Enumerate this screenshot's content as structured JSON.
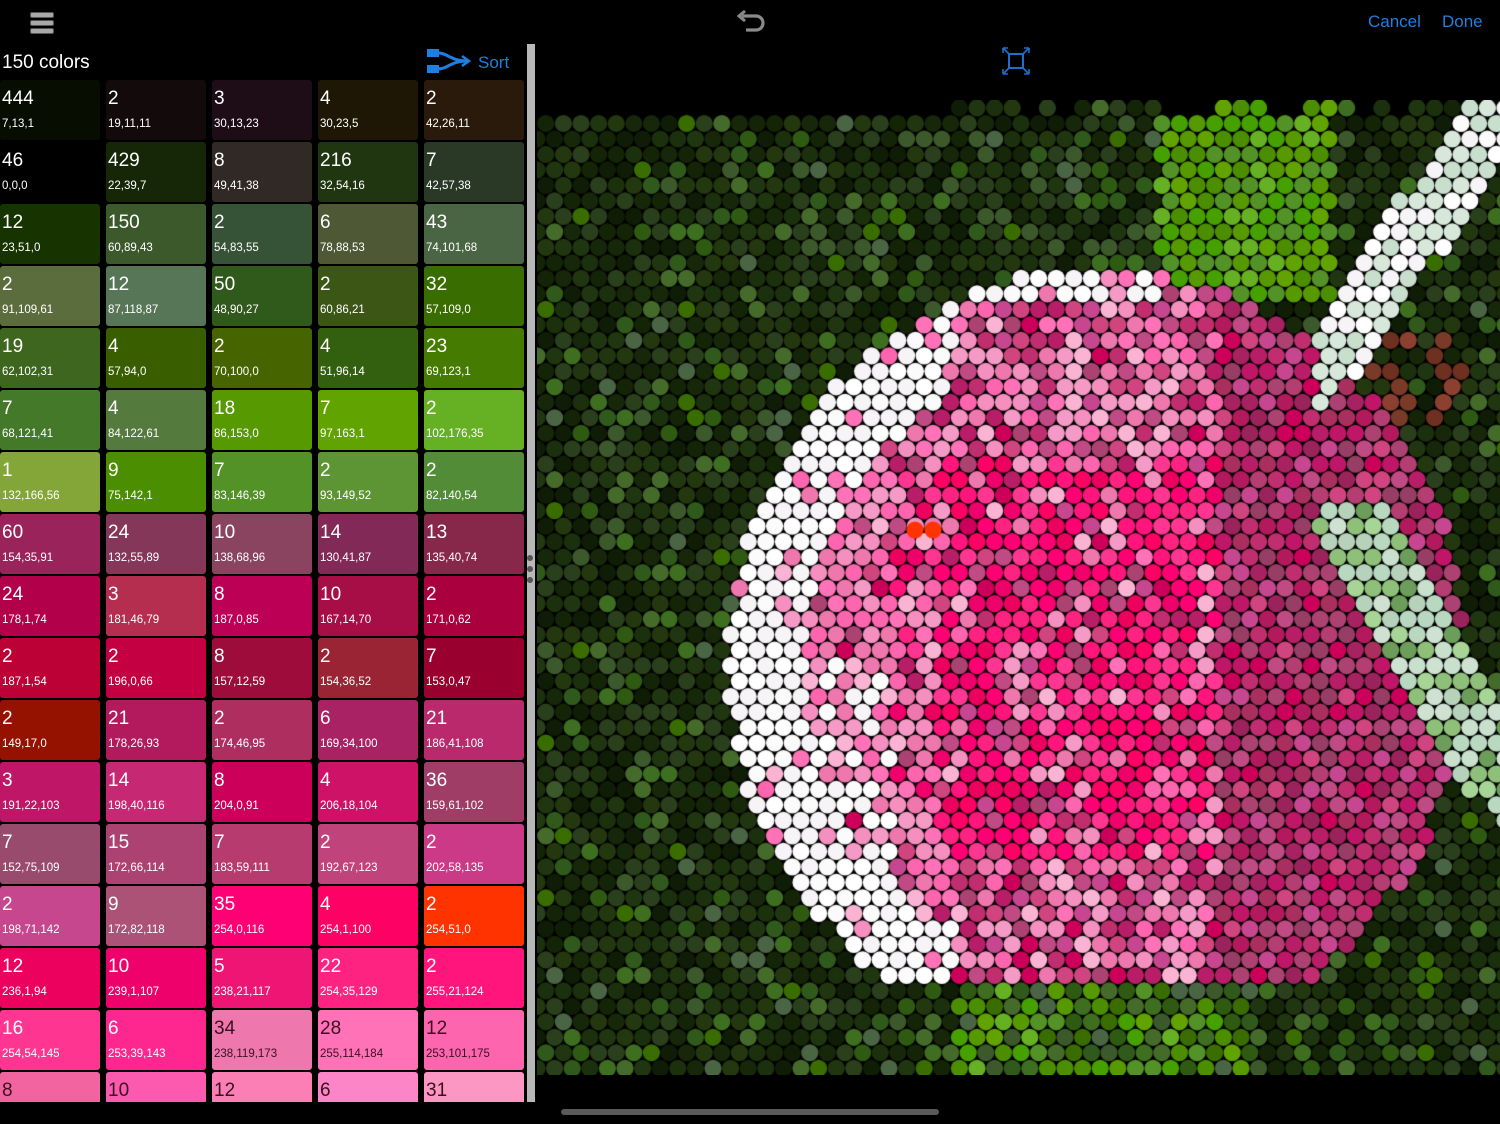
{
  "toolbar": {
    "menu_icon": "hamburger-menu-icon",
    "undo_icon": "undo-icon",
    "fit_icon": "fit-to-screen-icon",
    "cancel_label": "Cancel",
    "done_label": "Done",
    "accent_color": "#1f7fe0"
  },
  "palette_panel": {
    "count_label": "150 colors",
    "sort_label": "Sort",
    "sort_icon": "sort-branch-icon",
    "swatches": [
      {
        "count": "444",
        "rgb": "7,13,1"
      },
      {
        "count": "2",
        "rgb": "19,11,11"
      },
      {
        "count": "3",
        "rgb": "30,13,23"
      },
      {
        "count": "4",
        "rgb": "30,23,5"
      },
      {
        "count": "2",
        "rgb": "42,26,11"
      },
      {
        "count": "46",
        "rgb": "0,0,0"
      },
      {
        "count": "429",
        "rgb": "22,39,7"
      },
      {
        "count": "8",
        "rgb": "49,41,38"
      },
      {
        "count": "216",
        "rgb": "32,54,16"
      },
      {
        "count": "7",
        "rgb": "42,57,38"
      },
      {
        "count": "12",
        "rgb": "23,51,0"
      },
      {
        "count": "150",
        "rgb": "60,89,43"
      },
      {
        "count": "2",
        "rgb": "54,83,55"
      },
      {
        "count": "6",
        "rgb": "78,88,53"
      },
      {
        "count": "43",
        "rgb": "74,101,68"
      },
      {
        "count": "2",
        "rgb": "91,109,61"
      },
      {
        "count": "12",
        "rgb": "87,118,87"
      },
      {
        "count": "50",
        "rgb": "48,90,27"
      },
      {
        "count": "2",
        "rgb": "60,86,21"
      },
      {
        "count": "32",
        "rgb": "57,109,0"
      },
      {
        "count": "19",
        "rgb": "62,102,31"
      },
      {
        "count": "4",
        "rgb": "57,94,0"
      },
      {
        "count": "2",
        "rgb": "70,100,0"
      },
      {
        "count": "4",
        "rgb": "51,96,14"
      },
      {
        "count": "23",
        "rgb": "69,123,1"
      },
      {
        "count": "7",
        "rgb": "68,121,41"
      },
      {
        "count": "4",
        "rgb": "84,122,61"
      },
      {
        "count": "18",
        "rgb": "86,153,0"
      },
      {
        "count": "7",
        "rgb": "97,163,1"
      },
      {
        "count": "2",
        "rgb": "102,176,35"
      },
      {
        "count": "1",
        "rgb": "132,166,56"
      },
      {
        "count": "9",
        "rgb": "75,142,1"
      },
      {
        "count": "7",
        "rgb": "83,146,39"
      },
      {
        "count": "2",
        "rgb": "93,149,52"
      },
      {
        "count": "2",
        "rgb": "82,140,54"
      },
      {
        "count": "60",
        "rgb": "154,35,91"
      },
      {
        "count": "24",
        "rgb": "132,55,89"
      },
      {
        "count": "10",
        "rgb": "138,68,96"
      },
      {
        "count": "14",
        "rgb": "130,41,87"
      },
      {
        "count": "13",
        "rgb": "135,40,74"
      },
      {
        "count": "24",
        "rgb": "178,1,74"
      },
      {
        "count": "3",
        "rgb": "181,46,79"
      },
      {
        "count": "8",
        "rgb": "187,0,85"
      },
      {
        "count": "10",
        "rgb": "167,14,70"
      },
      {
        "count": "2",
        "rgb": "171,0,62"
      },
      {
        "count": "2",
        "rgb": "187,1,54"
      },
      {
        "count": "2",
        "rgb": "196,0,66"
      },
      {
        "count": "8",
        "rgb": "157,12,59"
      },
      {
        "count": "2",
        "rgb": "154,36,52"
      },
      {
        "count": "7",
        "rgb": "153,0,47"
      },
      {
        "count": "2",
        "rgb": "149,17,0"
      },
      {
        "count": "21",
        "rgb": "178,26,93"
      },
      {
        "count": "2",
        "rgb": "174,46,95"
      },
      {
        "count": "6",
        "rgb": "169,34,100"
      },
      {
        "count": "21",
        "rgb": "186,41,108"
      },
      {
        "count": "3",
        "rgb": "191,22,103"
      },
      {
        "count": "14",
        "rgb": "198,40,116"
      },
      {
        "count": "8",
        "rgb": "204,0,91"
      },
      {
        "count": "4",
        "rgb": "206,18,104"
      },
      {
        "count": "36",
        "rgb": "159,61,102"
      },
      {
        "count": "7",
        "rgb": "152,75,109"
      },
      {
        "count": "15",
        "rgb": "172,66,114"
      },
      {
        "count": "7",
        "rgb": "183,59,111"
      },
      {
        "count": "2",
        "rgb": "192,67,123"
      },
      {
        "count": "2",
        "rgb": "202,58,135"
      },
      {
        "count": "2",
        "rgb": "198,71,142"
      },
      {
        "count": "9",
        "rgb": "172,82,118"
      },
      {
        "count": "35",
        "rgb": "254,0,116"
      },
      {
        "count": "4",
        "rgb": "254,1,100"
      },
      {
        "count": "2",
        "rgb": "254,51,0"
      },
      {
        "count": "12",
        "rgb": "236,1,94"
      },
      {
        "count": "10",
        "rgb": "239,1,107"
      },
      {
        "count": "5",
        "rgb": "238,21,117"
      },
      {
        "count": "22",
        "rgb": "254,35,129"
      },
      {
        "count": "2",
        "rgb": "255,21,124"
      },
      {
        "count": "16",
        "rgb": "254,54,145"
      },
      {
        "count": "6",
        "rgb": "253,39,143"
      },
      {
        "count": "34",
        "rgb": "238,119,173"
      },
      {
        "count": "28",
        "rgb": "255,114,184"
      },
      {
        "count": "12",
        "rgb": "253,101,175"
      },
      {
        "count": "8",
        "rgb": "",
        "bg": "#f2649f"
      },
      {
        "count": "10",
        "rgb": "",
        "bg": "#fb5aae"
      },
      {
        "count": "12",
        "rgb": "",
        "bg": "#fb7fb4"
      },
      {
        "count": "6",
        "rgb": "",
        "bg": "#fb85c7"
      },
      {
        "count": "31",
        "rgb": "",
        "bg": "#fc97c4"
      }
    ]
  },
  "canvas": {
    "description": "dot-mosaic rendering of a pink rose with green leaves"
  }
}
